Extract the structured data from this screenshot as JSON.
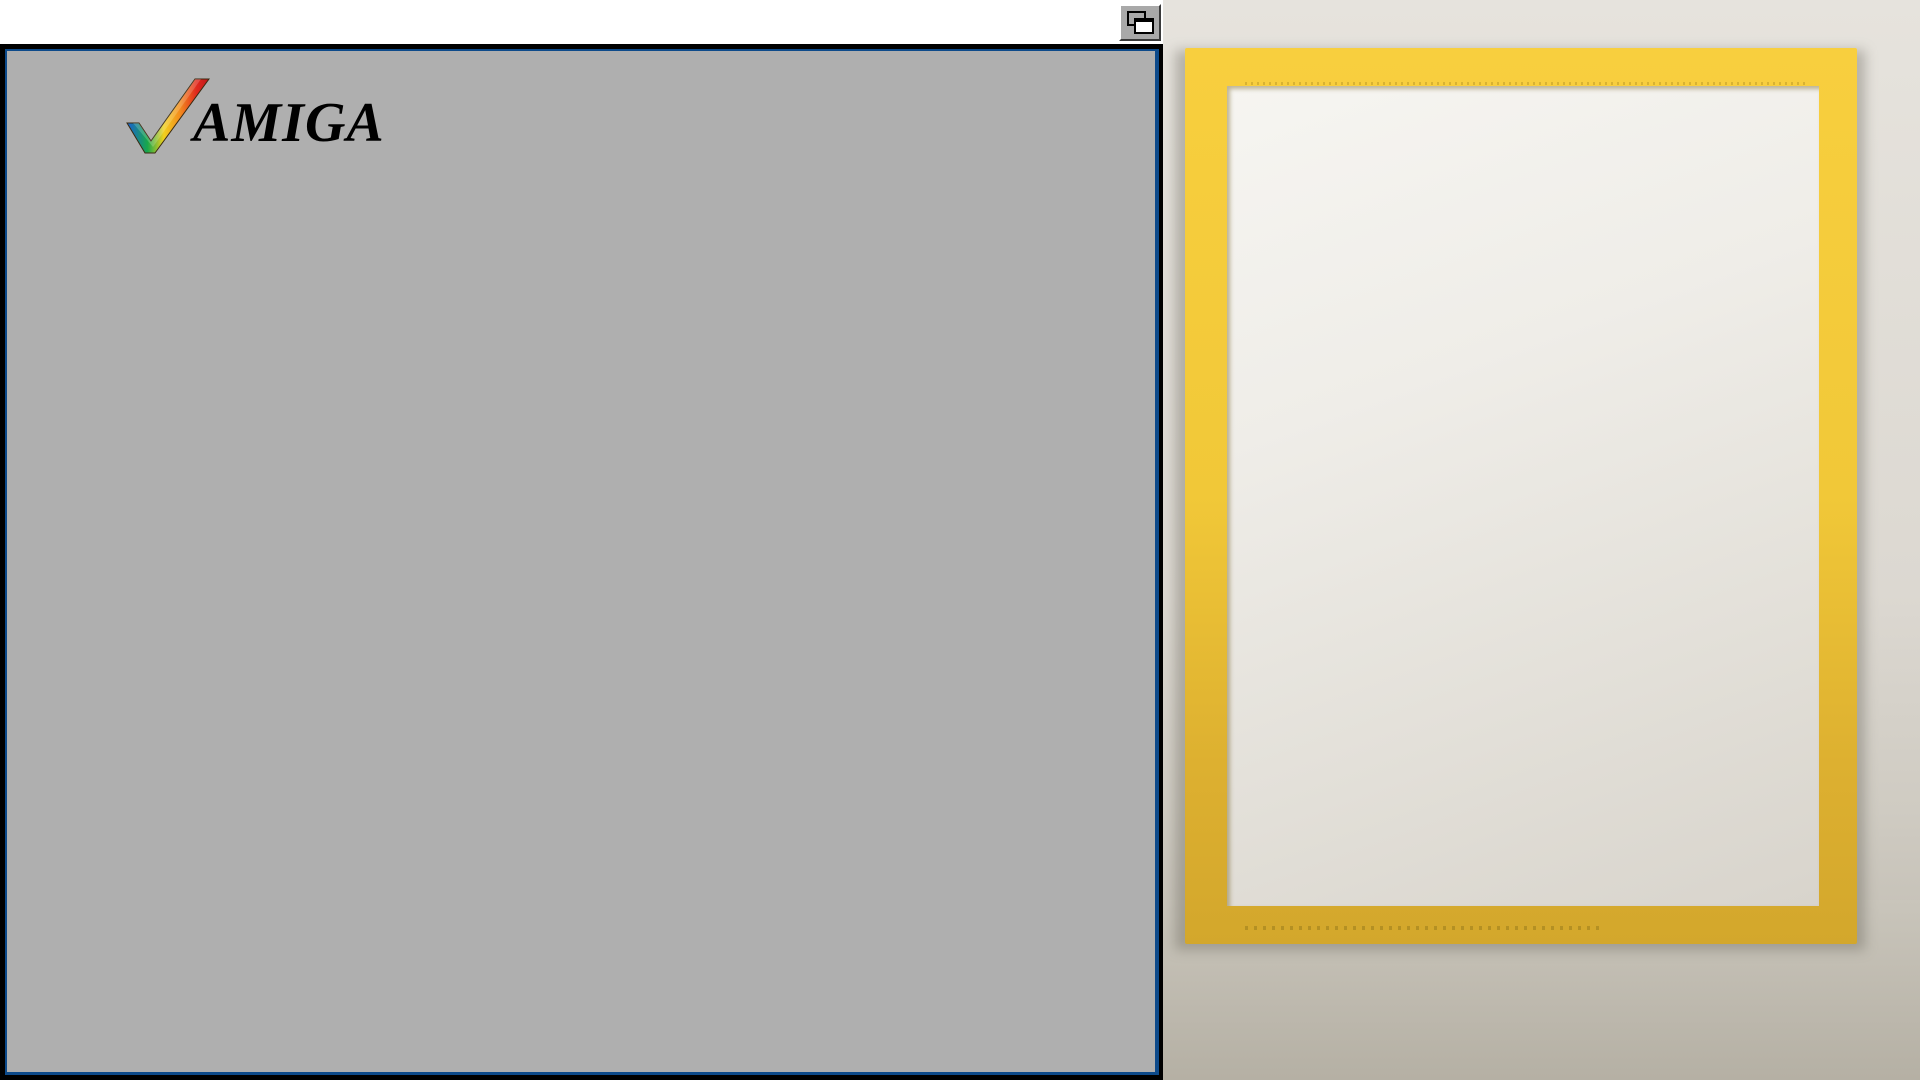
{
  "window": {
    "logo_text": "AMIGA",
    "logo_icon": "amiga-checkmark-logo",
    "depth_gadget_icon": "window-depth-icon",
    "background_color": "#afafaf",
    "frame_color": "#0d4a8a"
  },
  "artwork": {
    "frame_color": "#f3c93a",
    "canvas_color": "#efede8"
  }
}
